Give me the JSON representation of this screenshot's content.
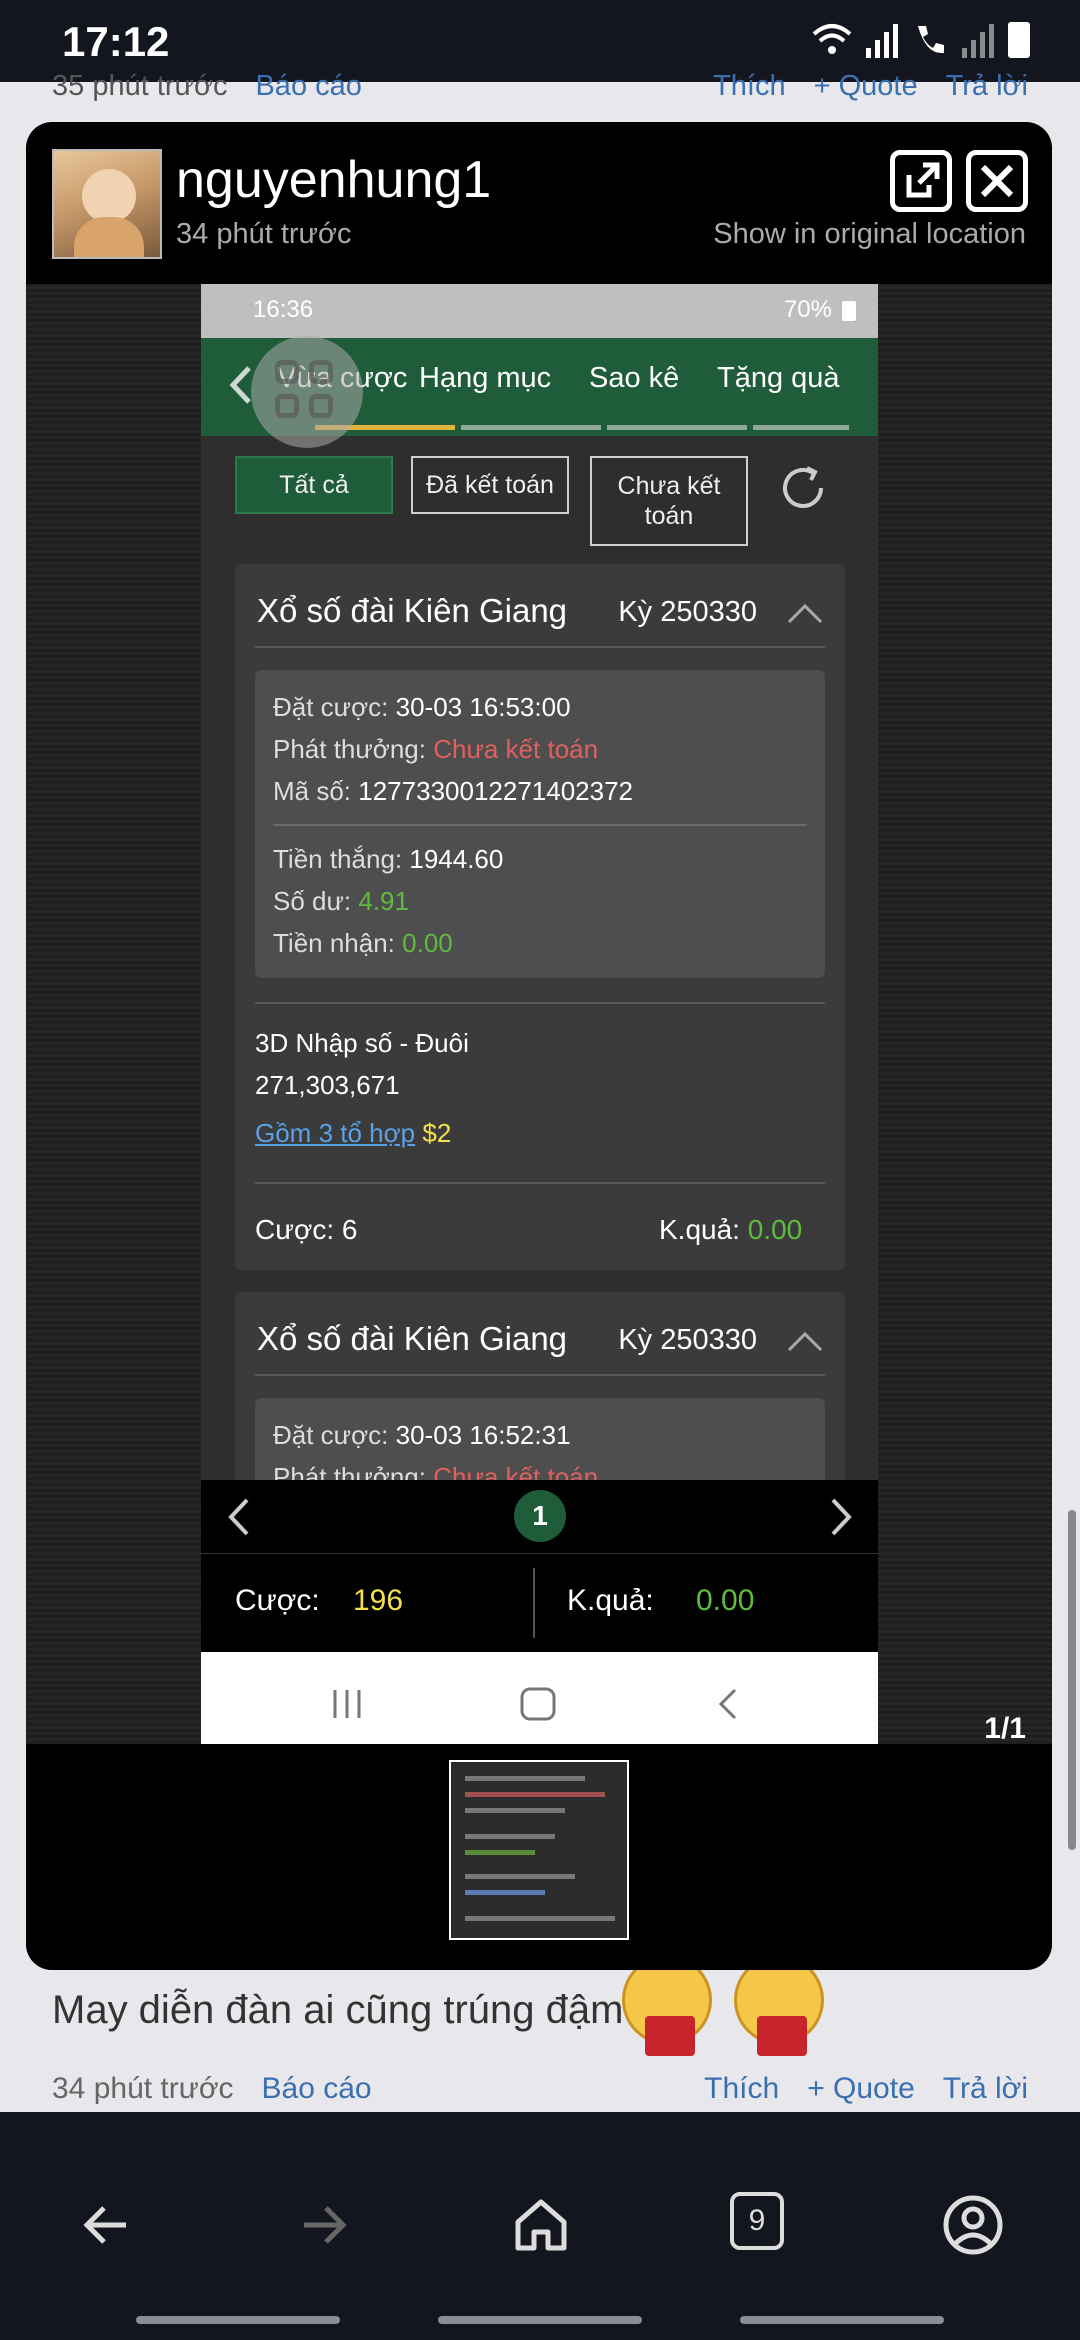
{
  "status_bar": {
    "time": "17:12"
  },
  "forum": {
    "prev_meta": {
      "ago": "35 phút trước",
      "report": "Báo cáo",
      "like": "Thích",
      "quote": "+ Quote",
      "reply": "Trả lời"
    },
    "post_text": "May diễn đàn ai cũng trúng đậm",
    "post_meta": {
      "ago": "34 phút trước",
      "report": "Báo cáo",
      "like": "Thích",
      "quote": "+ Quote",
      "reply": "Trả lời"
    }
  },
  "lightbox": {
    "username": "nguyenhung1",
    "ago": "34 phút trước",
    "show_original": "Show in original location",
    "counter": "1/1",
    "icons": [
      "open-external-icon",
      "close-icon"
    ]
  },
  "inner": {
    "status": {
      "time": "16:36",
      "battery": "70%"
    },
    "tabs": [
      "Vừa cược",
      "Hạng mục",
      "Sao kê",
      "Tặng quà"
    ],
    "filters": [
      "Tất cả",
      "Đã kết toán",
      "Chưa kết toán"
    ],
    "cards": [
      {
        "lottery": "Xổ số đài Kiên Giang",
        "ky": "Kỳ 250330",
        "bet_time_label": "Đặt cược:",
        "bet_time": "30-03 16:53:00",
        "payout_label": "Phát thưởng:",
        "payout": "Chưa kết toán",
        "code_label": "Mã số:",
        "code": "1277330012271402372",
        "win_label": "Tiền thắng:",
        "win": "1944.60",
        "balance_label": "Số dư:",
        "balance": "4.91",
        "received_label": "Tiền nhận:",
        "received": "0.00",
        "bet_type": "3D Nhập số - Đuôi",
        "numbers": "271,303,671",
        "combo": "Gồm 3 tổ hợp",
        "combo_price": "$2",
        "bet_label": "Cược:",
        "bet": "6",
        "result_label": "K.quả:",
        "result": "0.00"
      },
      {
        "lottery": "Xổ số đài Kiên Giang",
        "ky": "Kỳ 250330",
        "bet_time_label": "Đặt cược:",
        "bet_time": "30-03 16:52:31",
        "payout_label": "Phát thưởng:",
        "payout": "Chưa kết toán"
      }
    ],
    "page": "1",
    "totals": {
      "bet_label": "Cược:",
      "bet": "196",
      "result_label": "K.quả:",
      "result": "0.00"
    }
  },
  "browser": {
    "tab_count": "9"
  },
  "colors": {
    "nav_green": "#1f5c3a",
    "accent_yellow": "#e3b340",
    "red": "#e06060",
    "green": "#5fba3e"
  }
}
